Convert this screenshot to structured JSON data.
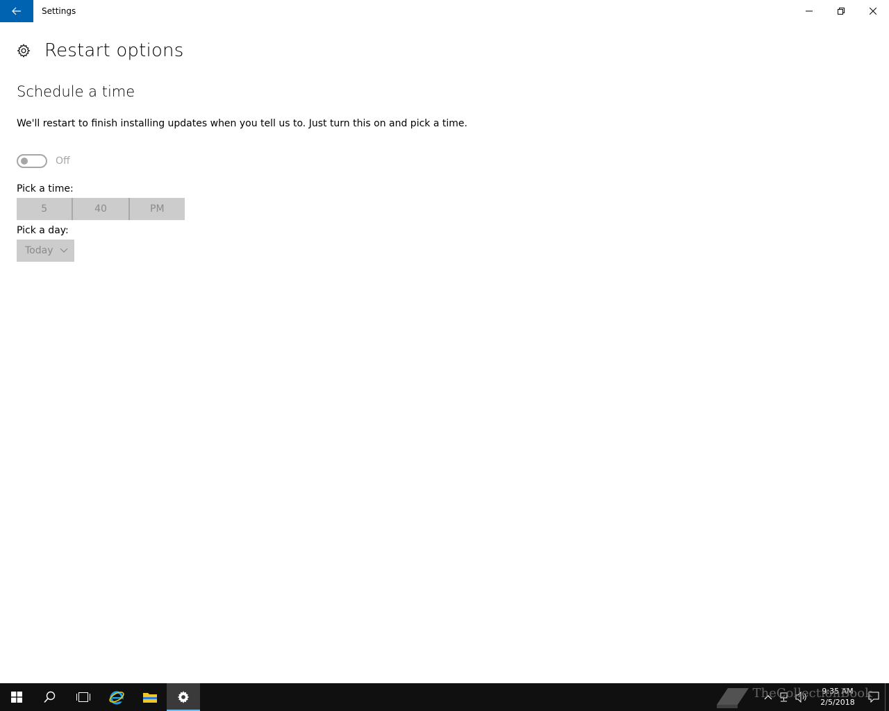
{
  "window": {
    "title": "Settings"
  },
  "page": {
    "title": "Restart options",
    "section_title": "Schedule a time",
    "description": "We'll restart to finish installing updates when you tell us to. Just turn this on and pick a time.",
    "toggle": {
      "state_label": "Off",
      "on": false
    },
    "time_label": "Pick a time:",
    "time": {
      "hour": "5",
      "minute": "40",
      "period": "PM"
    },
    "day_label": "Pick a day:",
    "day": {
      "selected": "Today"
    }
  },
  "taskbar": {
    "clock_time": "9:35 AM",
    "clock_date": "2/5/2018",
    "watermark": "TheCollectionBook"
  },
  "colors": {
    "accent": "#0063b1",
    "disabled_bg": "#cccccc",
    "disabled_text": "#8a8a8a",
    "taskbar": "#101010"
  }
}
